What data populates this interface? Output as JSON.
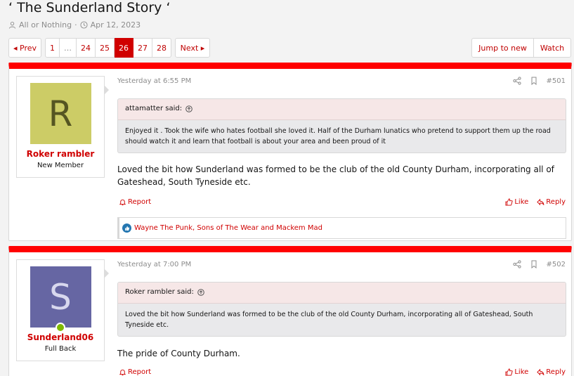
{
  "thread": {
    "title": "‘ The Sunderland Story ‘",
    "author": "All or Nothing",
    "separator": "·",
    "date": "Apr 12, 2023"
  },
  "pagination": {
    "prev": "◂ Prev",
    "next": "Next ▸",
    "pages": [
      "1",
      "…",
      "24",
      "25",
      "26",
      "27",
      "28"
    ],
    "current": "26"
  },
  "actions": {
    "jump": "Jump to new",
    "watch": "Watch"
  },
  "posts": [
    {
      "avatar_letter": "R",
      "username": "Roker rambler",
      "user_title": "New Member",
      "time": "Yesterday at 6:55 PM",
      "number": "#501",
      "quote_author": "attamatter said:",
      "quote_text": "Enjoyed it . Took the wife who hates football she loved it. Half of the Durham lunatics who pretend to support them up the road should watch it and learn that football is about your area and been proud of it",
      "body": "Loved the bit how Sunderland was formed to be the club of the old County Durham, incorporating all of Gateshead, South Tyneside etc.",
      "report": "Report",
      "like": "Like",
      "reply": "Reply",
      "reactions": "Wayne The Punk, Sons of The Wear and Mackem Mad"
    },
    {
      "avatar_letter": "S",
      "username": "Sunderland06",
      "user_title": "Full Back",
      "time": "Yesterday at 7:00 PM",
      "number": "#502",
      "quote_author": "Roker rambler said:",
      "quote_text": "Loved the bit how Sunderland was formed to be the club of the old County Durham, incorporating all of Gateshead, South Tyneside etc.",
      "body": "The pride of County Durham.",
      "report": "Report",
      "like": "Like",
      "reply": "Reply"
    }
  ],
  "colors": {
    "accent": "#d00000",
    "post_bar": "#ff0000",
    "avatar_r": "#cccc66",
    "avatar_s": "#6666a3",
    "online": "#7fb900"
  }
}
